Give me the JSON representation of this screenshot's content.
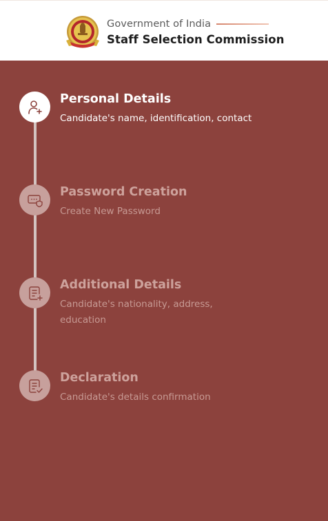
{
  "header": {
    "subtitle": "Government of India",
    "title": "Staff Selection Commission"
  },
  "steps": [
    {
      "title": "Personal Details",
      "description": "Candidate's name, identification, contact",
      "icon": "user-add-icon",
      "state": "active"
    },
    {
      "title": "Password Creation",
      "description": "Create New Password",
      "icon": "password-shield-icon",
      "state": "inactive"
    },
    {
      "title": "Additional Details",
      "description": "Candidate's nationality, address, education",
      "icon": "document-add-icon",
      "state": "inactive"
    },
    {
      "title": "Declaration",
      "description": "Candidate's details confirmation",
      "icon": "document-check-icon",
      "state": "inactive"
    }
  ],
  "colors": {
    "panel": "#8c423d",
    "active": "#ffffff",
    "inactive_circle": "#c7a09c",
    "inactive_text": "#cda29c"
  }
}
